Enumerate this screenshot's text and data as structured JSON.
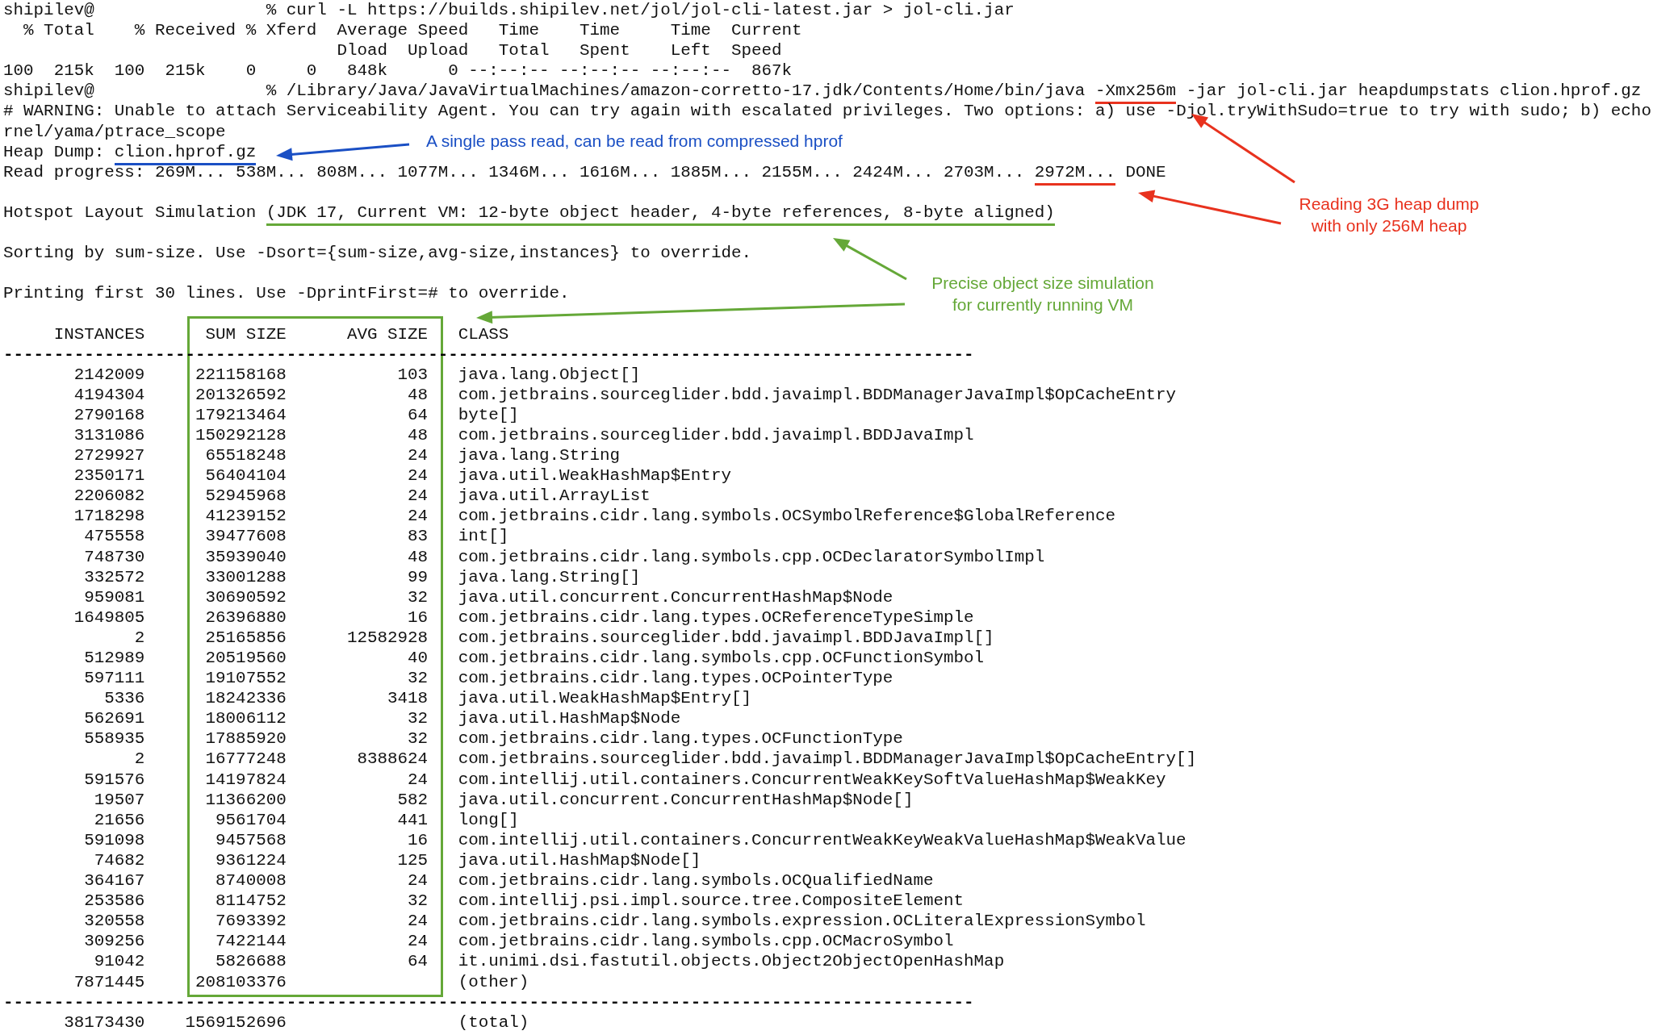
{
  "terminal": {
    "output_lines": [
      {
        "parts": [
          {
            "text": "shipilev@                 % curl -L https://builds.shipilev.net/jol/jol-cli-latest.jar > jol-cli.jar"
          }
        ]
      },
      {
        "parts": [
          {
            "text": "  % Total    % Received % Xferd  Average Speed   Time    Time     Time  Current"
          }
        ]
      },
      {
        "parts": [
          {
            "text": "                                 Dload  Upload   Total   Spent    Left  Speed"
          }
        ]
      },
      {
        "parts": [
          {
            "text": "100  215k  100  215k    0     0   848k      0 --:--:-- --:--:-- --:--:--  867k"
          }
        ]
      },
      {
        "parts": [
          {
            "text": "shipilev@                 % /Library/Java/JavaVirtualMachines/amazon-corretto-17.jdk/Contents/Home/bin/java "
          },
          {
            "text": "-Xmx256m",
            "color": "#e8321e"
          },
          {
            "text": " -jar jol-cli.jar heapdumpstats clion.hprof.gz"
          }
        ]
      },
      {
        "parts": [
          {
            "text": "# WARNING: Unable to attach Serviceability Agent. You can try again with escalated privileges. Two options: a) use -Djol.tryWithSudo=true to try with sudo; b) echo"
          }
        ]
      },
      {
        "parts": [
          {
            "text": "rnel/yama/ptrace_scope"
          }
        ]
      },
      {
        "parts": [
          {
            "text": "Heap Dump: "
          },
          {
            "text": "clion.hprof.gz",
            "color": "#1a4fc4"
          }
        ]
      },
      {
        "parts": [
          {
            "text": "Read progress: 269M... 538M... 808M... 1077M... 1346M... 1616M... 1885M... 2155M... 2424M... 2703M... "
          },
          {
            "text": "2972M...",
            "color": "#e8321e"
          },
          {
            "text": " DONE"
          }
        ]
      }
    ],
    "messages": [
      {
        "parts": [
          {
            "text": "Hotspot Layout Simulation "
          },
          {
            "text": "(JDK 17, Current VM: 12-byte object header, 4-byte references, 8-byte aligned)",
            "color": "#65a838"
          }
        ]
      },
      {
        "parts": [
          {
            "text": "Sorting by sum-size. Use -Dsort={sum-size,avg-size,instances} to override."
          }
        ]
      },
      {
        "parts": [
          {
            "text": "Printing first 30 lines. Use -DprintFirst=# to override."
          }
        ]
      }
    ],
    "table": {
      "columns": [
        "INSTANCES",
        "SUM SIZE",
        "AVG SIZE",
        "CLASS"
      ],
      "separator_top": "------------------------------------------------------------------------------------------------",
      "rows": [
        {
          "instances": "2142009",
          "sum_size": "221158168",
          "avg_size": "103",
          "class": "java.lang.Object[]"
        },
        {
          "instances": "4194304",
          "sum_size": "201326592",
          "avg_size": "48",
          "class": "com.jetbrains.sourceglider.bdd.javaimpl.BDDManagerJavaImpl$OpCacheEntry"
        },
        {
          "instances": "2790168",
          "sum_size": "179213464",
          "avg_size": "64",
          "class": "byte[]"
        },
        {
          "instances": "3131086",
          "sum_size": "150292128",
          "avg_size": "48",
          "class": "com.jetbrains.sourceglider.bdd.javaimpl.BDDJavaImpl"
        },
        {
          "instances": "2729927",
          "sum_size": "65518248",
          "avg_size": "24",
          "class": "java.lang.String"
        },
        {
          "instances": "2350171",
          "sum_size": "56404104",
          "avg_size": "24",
          "class": "java.util.WeakHashMap$Entry"
        },
        {
          "instances": "2206082",
          "sum_size": "52945968",
          "avg_size": "24",
          "class": "java.util.ArrayList"
        },
        {
          "instances": "1718298",
          "sum_size": "41239152",
          "avg_size": "24",
          "class": "com.jetbrains.cidr.lang.symbols.OCSymbolReference$GlobalReference"
        },
        {
          "instances": "475558",
          "sum_size": "39477608",
          "avg_size": "83",
          "class": "int[]"
        },
        {
          "instances": "748730",
          "sum_size": "35939040",
          "avg_size": "48",
          "class": "com.jetbrains.cidr.lang.symbols.cpp.OCDeclaratorSymbolImpl"
        },
        {
          "instances": "332572",
          "sum_size": "33001288",
          "avg_size": "99",
          "class": "java.lang.String[]"
        },
        {
          "instances": "959081",
          "sum_size": "30690592",
          "avg_size": "32",
          "class": "java.util.concurrent.ConcurrentHashMap$Node"
        },
        {
          "instances": "1649805",
          "sum_size": "26396880",
          "avg_size": "16",
          "class": "com.jetbrains.cidr.lang.types.OCReferenceTypeSimple"
        },
        {
          "instances": "2",
          "sum_size": "25165856",
          "avg_size": "12582928",
          "class": "com.jetbrains.sourceglider.bdd.javaimpl.BDDJavaImpl[]"
        },
        {
          "instances": "512989",
          "sum_size": "20519560",
          "avg_size": "40",
          "class": "com.jetbrains.cidr.lang.symbols.cpp.OCFunctionSymbol"
        },
        {
          "instances": "597111",
          "sum_size": "19107552",
          "avg_size": "32",
          "class": "com.jetbrains.cidr.lang.types.OCPointerType"
        },
        {
          "instances": "5336",
          "sum_size": "18242336",
          "avg_size": "3418",
          "class": "java.util.WeakHashMap$Entry[]"
        },
        {
          "instances": "562691",
          "sum_size": "18006112",
          "avg_size": "32",
          "class": "java.util.HashMap$Node"
        },
        {
          "instances": "558935",
          "sum_size": "17885920",
          "avg_size": "32",
          "class": "com.jetbrains.cidr.lang.types.OCFunctionType"
        },
        {
          "instances": "2",
          "sum_size": "16777248",
          "avg_size": "8388624",
          "class": "com.jetbrains.sourceglider.bdd.javaimpl.BDDManagerJavaImpl$OpCacheEntry[]"
        },
        {
          "instances": "591576",
          "sum_size": "14197824",
          "avg_size": "24",
          "class": "com.intellij.util.containers.ConcurrentWeakKeySoftValueHashMap$WeakKey"
        },
        {
          "instances": "19507",
          "sum_size": "11366200",
          "avg_size": "582",
          "class": "java.util.concurrent.ConcurrentHashMap$Node[]"
        },
        {
          "instances": "21656",
          "sum_size": "9561704",
          "avg_size": "441",
          "class": "long[]"
        },
        {
          "instances": "591098",
          "sum_size": "9457568",
          "avg_size": "16",
          "class": "com.intellij.util.containers.ConcurrentWeakKeyWeakValueHashMap$WeakValue"
        },
        {
          "instances": "74682",
          "sum_size": "9361224",
          "avg_size": "125",
          "class": "java.util.HashMap$Node[]"
        },
        {
          "instances": "364167",
          "sum_size": "8740008",
          "avg_size": "24",
          "class": "com.jetbrains.cidr.lang.symbols.OCQualifiedName"
        },
        {
          "instances": "253586",
          "sum_size": "8114752",
          "avg_size": "32",
          "class": "com.intellij.psi.impl.source.tree.CompositeElement"
        },
        {
          "instances": "320558",
          "sum_size": "7693392",
          "avg_size": "24",
          "class": "com.jetbrains.cidr.lang.symbols.expression.OCLiteralExpressionSymbol"
        },
        {
          "instances": "309256",
          "sum_size": "7422144",
          "avg_size": "24",
          "class": "com.jetbrains.cidr.lang.symbols.cpp.OCMacroSymbol"
        },
        {
          "instances": "91042",
          "sum_size": "5826688",
          "avg_size": "64",
          "class": "it.unimi.dsi.fastutil.objects.Object2ObjectOpenHashMap"
        },
        {
          "instances": "7871445",
          "sum_size": "208103376",
          "class": "(other)"
        }
      ],
      "separator_bottom": "------------------------------------------------------------------------------------------------",
      "total": {
        "instances": "38173430",
        "sum_size": "1569152696",
        "class": "(total)"
      }
    }
  },
  "annotations": [
    {
      "text": "A single pass read, can be read from compressed hprof",
      "color": "#1a4fc4"
    },
    {
      "text": "Reading 3G heap dump\nwith only 256M heap",
      "color": "#e8321e"
    },
    {
      "text": "Precise object size simulation\nfor currently running VM",
      "color": "#65a838"
    }
  ]
}
